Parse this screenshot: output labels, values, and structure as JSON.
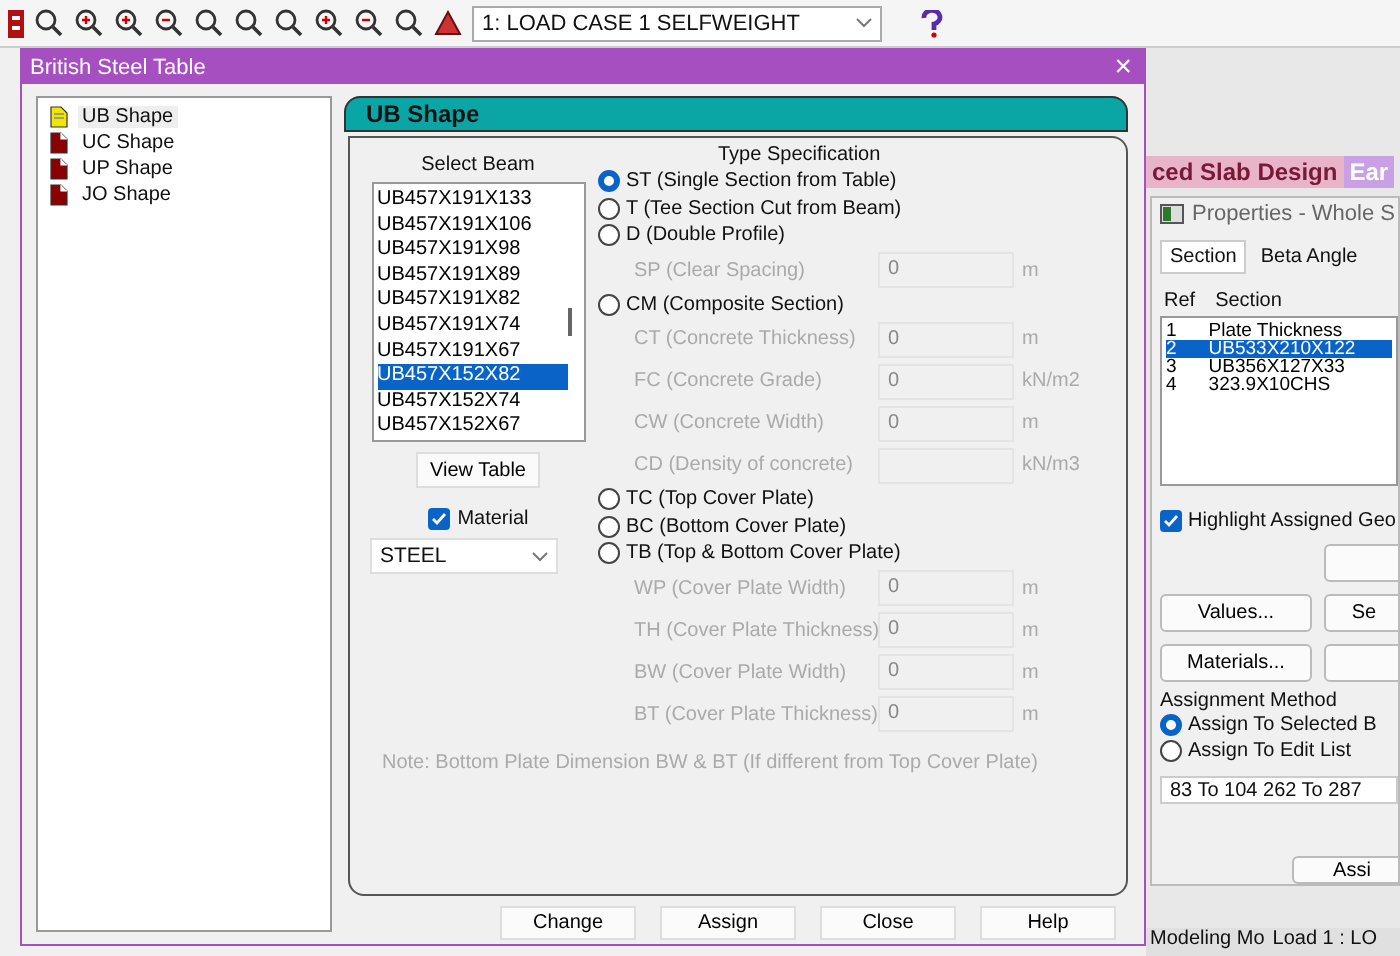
{
  "toolbar": {
    "load_case": "1: LOAD CASE 1 SELFWEIGHT"
  },
  "background": {
    "tabs": [
      {
        "label": "ced Slab Design",
        "selected": true
      },
      {
        "label": "Ear",
        "selected": false
      }
    ],
    "properties": {
      "title": "Properties - Whole S",
      "tabs": [
        {
          "label": "Section",
          "selected": true
        },
        {
          "label": "Beta Angle",
          "selected": false
        }
      ],
      "columns": [
        "Ref",
        "Section"
      ],
      "rows": [
        {
          "ref": "1",
          "section": "Plate Thickness",
          "selected": false
        },
        {
          "ref": "2",
          "section": "UB533X210X122",
          "selected": true
        },
        {
          "ref": "3",
          "section": "UB356X127X33",
          "selected": false
        },
        {
          "ref": "4",
          "section": "323.9X10CHS",
          "selected": false
        }
      ],
      "highlight": {
        "label": "Highlight Assigned Geo",
        "checked": true
      },
      "buttons": [
        {
          "label": "Values..."
        },
        {
          "label": "Se"
        },
        {
          "label": "Materials..."
        }
      ],
      "assignment": {
        "title": "Assignment Method",
        "options": [
          {
            "label": "Assign To Selected B",
            "selected": true
          },
          {
            "label": "Assign To Edit List",
            "selected": false
          }
        ],
        "list": "83 To 104 262 To 287"
      },
      "assign_button": "Assi"
    },
    "status_bar": [
      "Modeling Mo",
      "Load 1 : LO"
    ]
  },
  "dialog": {
    "title": "British Steel Table",
    "close": "×",
    "tree": [
      {
        "label": "UB Shape",
        "selected": true
      },
      {
        "label": "UC Shape",
        "selected": false
      },
      {
        "label": "UP Shape",
        "selected": false
      },
      {
        "label": "JO Shape",
        "selected": false
      }
    ],
    "panel_title": "UB Shape",
    "select_beam": {
      "label": "Select Beam",
      "items": [
        {
          "label": "UB457X191X133",
          "selected": false
        },
        {
          "label": "UB457X191X106",
          "selected": false
        },
        {
          "label": "UB457X191X98",
          "selected": false
        },
        {
          "label": "UB457X191X89",
          "selected": false
        },
        {
          "label": "UB457X191X82",
          "selected": false
        },
        {
          "label": "UB457X191X74",
          "selected": false
        },
        {
          "label": "UB457X191X67",
          "selected": false
        },
        {
          "label": "UB457X152X82",
          "selected": true
        },
        {
          "label": "UB457X152X74",
          "selected": false
        },
        {
          "label": "UB457X152X67",
          "selected": false
        }
      ],
      "view_table": "View Table",
      "material": {
        "label": "Material",
        "checked": true
      },
      "material_value": "STEEL"
    },
    "type_spec": {
      "title": "Type Specification",
      "options": [
        {
          "kind": "radio",
          "label": "ST (Single Section from Table)",
          "selected": true
        },
        {
          "kind": "radio",
          "label": "T (Tee Section Cut from Beam)",
          "selected": false
        },
        {
          "kind": "radio",
          "label": "D (Double Profile)",
          "selected": false
        },
        {
          "kind": "field",
          "label": "SP (Clear Spacing)",
          "value": "0",
          "unit": "m"
        },
        {
          "kind": "radio",
          "label": "CM (Composite Section)",
          "selected": false
        },
        {
          "kind": "field",
          "label": "CT (Concrete Thickness)",
          "value": "0",
          "unit": "m"
        },
        {
          "kind": "field",
          "label": "FC (Concrete Grade)",
          "value": "0",
          "unit": "kN/m2"
        },
        {
          "kind": "field",
          "label": "CW (Concrete Width)",
          "value": "0",
          "unit": "m"
        },
        {
          "kind": "field",
          "label": "CD (Density of concrete)",
          "unit": "kN/m3"
        },
        {
          "kind": "radio",
          "label": "TC (Top Cover Plate)",
          "selected": false
        },
        {
          "kind": "radio",
          "label": "BC (Bottom Cover Plate)",
          "selected": false
        },
        {
          "kind": "radio",
          "label": "TB (Top & Bottom Cover Plate)",
          "selected": false
        },
        {
          "kind": "field",
          "label": "WP (Cover Plate Width)",
          "value": "0",
          "unit": "m"
        },
        {
          "kind": "field",
          "label": "TH (Cover Plate Thickness)",
          "value": "0",
          "unit": "m"
        },
        {
          "kind": "field",
          "label": "BW (Cover Plate Width)",
          "value": "0",
          "unit": "m"
        },
        {
          "kind": "field",
          "label": "BT (Cover Plate Thickness)",
          "value": "0",
          "unit": "m"
        }
      ]
    },
    "note": "Note: Bottom Plate Dimension BW & BT (If different from Top Cover Plate)",
    "buttons": [
      "Change",
      "Assign",
      "Close",
      "Help"
    ]
  }
}
